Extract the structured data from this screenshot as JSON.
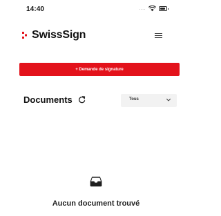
{
  "status_bar": {
    "time": "14:40",
    "signal_indicator": "....",
    "wifi_icon": "wifi-icon",
    "battery_icon": "battery-icon"
  },
  "header": {
    "brand": "SwissSign",
    "logo_icon": "swisssign-logo-icon",
    "brand_color": "#e3121b",
    "menu_icon": "hamburger-menu-icon"
  },
  "actions": {
    "new_request_label": "+ Demande de signature",
    "button_color": "#e3121b"
  },
  "documents": {
    "title": "Documents",
    "refresh_icon": "refresh-icon",
    "filter": {
      "selected": "Tous",
      "icon": "chevron-down-icon"
    }
  },
  "empty_state": {
    "icon": "inbox-icon",
    "message": "Aucun document trouvé"
  }
}
